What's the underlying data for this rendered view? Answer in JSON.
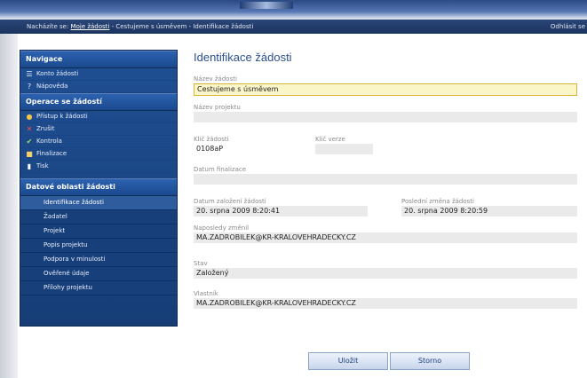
{
  "header": {
    "breadcrumb": [
      "Nacházíte se:",
      "Moje žádosti",
      "Cestujeme s úsměvem",
      "Identifikace žádosti"
    ],
    "logout": "Odhlásit se"
  },
  "sidebar": {
    "nav_title": "Navigace",
    "nav_items": [
      {
        "label": "Konto žádosti",
        "icon": "list-icon"
      },
      {
        "label": "Nápověda",
        "icon": "help-icon"
      }
    ],
    "ops_title": "Operace se žádostí",
    "ops_items": [
      {
        "label": "Přístup k žádosti",
        "icon": "users-icon"
      },
      {
        "label": "Zrušit",
        "icon": "cross-icon"
      },
      {
        "label": "Kontrola",
        "icon": "check-icon"
      },
      {
        "label": "Finalizace",
        "icon": "lock-icon"
      },
      {
        "label": "Tisk",
        "icon": "print-icon"
      }
    ],
    "other_title": "Datové oblasti žádosti",
    "other_items": [
      "Identifikace žádosti",
      "Žadatel",
      "Projekt",
      "Popis projektu",
      "Podpora v minulosti",
      "Ověřené údaje",
      "Přílohy projektu"
    ],
    "active_item": "Identifikace žádosti"
  },
  "form": {
    "title": "Identifikace žádosti",
    "nazev_zadosti_label": "Název žádosti",
    "nazev_zadosti_value": "Cestujeme s úsměvem",
    "nazev_projektu_label": "Název projektu",
    "nazev_projektu_value": "",
    "hash_zadosti_label": "Klíč žádosti",
    "hash_zadosti_value": "0108aP",
    "hash_verze_label": "Klíč verze",
    "hash_verze_value": "",
    "datum_finalizace_label": "Datum finalizace",
    "datum_finalizace_value": "",
    "datum_zalozeni_label": "Datum založení žádosti",
    "datum_zalozeni_value": "20. srpna 2009 8:20:41",
    "posledni_zmena_label": "Poslední změna žádosti",
    "posledni_zmena_value": "20. srpna 2009 8:20:59",
    "naposledy_zmenil_label": "Naposledy změnil",
    "naposledy_zmenil_value": "MA.ZADROBILEK@KR-KRALOVEHRADECKY.CZ",
    "stav_label": "Stav",
    "stav_value": "Založený",
    "vlastnik_label": "Vlastník",
    "vlastnik_value": "MA.ZADROBILEK@KR-KRALOVEHRADECKY.CZ"
  },
  "buttons": {
    "save": "Uložit",
    "cancel": "Storno"
  }
}
